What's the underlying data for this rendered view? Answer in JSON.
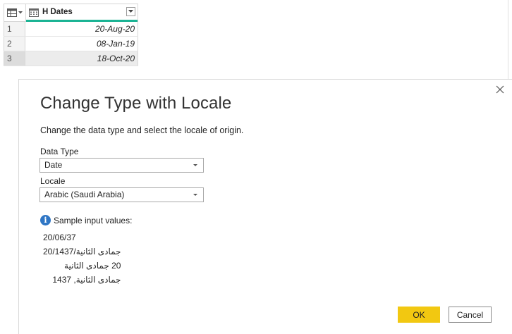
{
  "table": {
    "column_header": "H Dates",
    "rows": [
      {
        "num": "1",
        "value": "20-Aug-20"
      },
      {
        "num": "2",
        "value": "08-Jan-19"
      },
      {
        "num": "3",
        "value": "18-Oct-20"
      }
    ],
    "header_accent_color": "#1ab394"
  },
  "dialog": {
    "title": "Change Type with Locale",
    "subtitle": "Change the data type and select the locale of origin.",
    "data_type_label": "Data Type",
    "data_type_value": "Date",
    "locale_label": "Locale",
    "locale_value": "Arabic (Saudi Arabia)",
    "sample_heading": "Sample input values:",
    "samples": [
      "20/06/37",
      "جمادى الثانية/20/1437",
      "20 جمادى الثانية",
      "جمادى الثانية, 1437"
    ],
    "ok_label": "OK",
    "cancel_label": "Cancel",
    "accent_color": "#f2c811"
  }
}
